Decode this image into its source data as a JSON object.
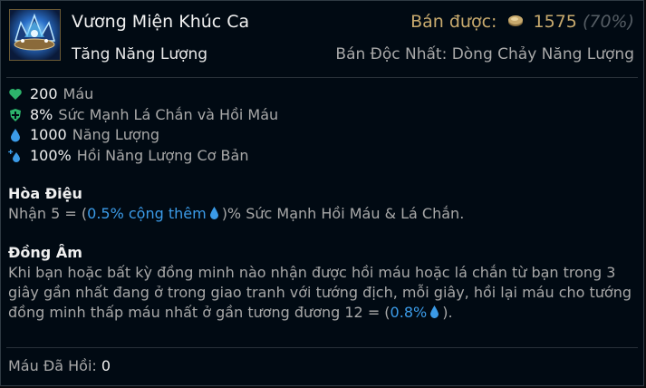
{
  "item": {
    "name": "Vương Miện Khúc Ca",
    "subtitle": "Tăng Năng Lượng",
    "sell_label": "Bán được:",
    "sell_value": "1575",
    "sell_percent": "(70%)",
    "unique_label": "Bán Độc Nhất: Dòng Chảy Năng Lượng"
  },
  "stats": [
    {
      "value": "200",
      "name": "Máu",
      "icon": "heart-icon"
    },
    {
      "value": "8%",
      "name": "Sức Mạnh Lá Chắn và Hồi Máu",
      "icon": "heal-shield-icon"
    },
    {
      "value": "1000",
      "name": "Năng Lượng",
      "icon": "mana-drop-icon"
    },
    {
      "value": "100%",
      "name": "Hồi Năng Lượng Cơ Bản",
      "icon": "mana-regen-icon"
    }
  ],
  "passive1": {
    "title": "Hòa Điệu",
    "text_prefix": "Nhận 5 = (",
    "text_blue": "0.5% cộng thêm",
    "text_suffix": ")% Sức Mạnh Hồi Máu & Lá Chắn."
  },
  "passive2": {
    "title": "Đồng Âm",
    "text_main": "Khi bạn hoặc bất kỳ đồng minh nào nhận được hồi máu hoặc lá chắn từ bạn trong 3 giây gần nhất đang ở trong giao tranh với tướng địch, mỗi giây, hồi lại máu cho tướng đồng minh thấp máu nhất ở gần tương đương 12 = (",
    "text_blue": "0.8%",
    "text_end": ")."
  },
  "footer": {
    "label": "Máu Đã Hồi:",
    "value": "0"
  },
  "colors": {
    "gold": "#c8aa6e",
    "mana_blue": "#3b9be8",
    "health_green": "#2db36b"
  }
}
